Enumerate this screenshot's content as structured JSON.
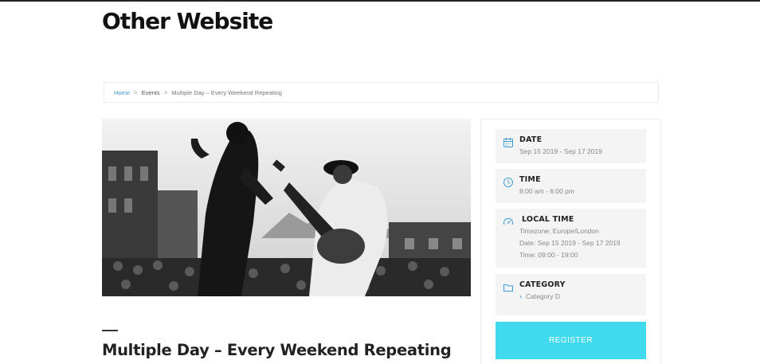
{
  "site": {
    "title": "Other Website"
  },
  "breadcrumb": {
    "home": "Home",
    "events": "Events",
    "current": "Multiple Day – Every Weekend Repeating",
    "separator": ">"
  },
  "event": {
    "title": "Multiple Day – Every Weekend Repeating",
    "image_alt": "concert-photo"
  },
  "sidebar": {
    "date": {
      "label": "DATE",
      "value": "Sep 15 2019 - Sep 17 2019",
      "icon": "calendar-icon"
    },
    "time": {
      "label": "TIME",
      "value": "8:00 am - 6:00 pm",
      "icon": "clock-icon"
    },
    "local_time": {
      "label": "LOCAL TIME",
      "timezone": "Timezone: Europe/London",
      "date": "Date: Sep 15 2019 - Sep 17 2019",
      "time": "Time: 09:00 - 19:00",
      "icon": "gauge-icon"
    },
    "category": {
      "label": "CATEGORY",
      "value": "Category D",
      "icon": "folder-icon"
    },
    "register_label": "REGISTER"
  },
  "colors": {
    "accent": "#40d9ee",
    "link": "#3d9cd6",
    "card_bg": "#f4f4f4"
  }
}
